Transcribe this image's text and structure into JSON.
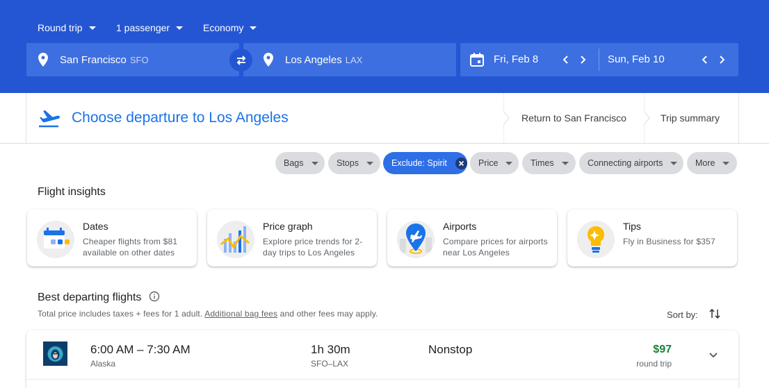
{
  "search": {
    "trip_type": "Round trip",
    "passengers": "1 passenger",
    "cabin": "Economy",
    "origin_city": "San Francisco",
    "origin_code": "SFO",
    "destination_city": "Los Angeles",
    "destination_code": "LAX",
    "depart_date": "Fri, Feb 8",
    "return_date": "Sun, Feb 10"
  },
  "steps": {
    "current": "Choose departure to Los Angeles",
    "next": "Return to San Francisco",
    "summary": "Trip summary"
  },
  "filters": [
    {
      "label": "Bags"
    },
    {
      "label": "Stops"
    },
    {
      "label": "Exclude: Spirit"
    },
    {
      "label": "Price"
    },
    {
      "label": "Times"
    },
    {
      "label": "Connecting airports"
    },
    {
      "label": "More"
    }
  ],
  "insights": {
    "heading": "Flight insights",
    "cards": [
      {
        "title": "Dates",
        "desc": "Cheaper flights from $81 available on other dates"
      },
      {
        "title": "Price graph",
        "desc": "Explore price trends for 2-day trips to Los Angeles"
      },
      {
        "title": "Airports",
        "desc": "Compare prices for airports near Los Angeles"
      },
      {
        "title": "Tips",
        "desc": "Fly in Business for $357"
      }
    ]
  },
  "results": {
    "heading": "Best departing flights",
    "note_prefix": "Total price includes taxes + fees for 1 adult.",
    "note_link": "Additional bag fees",
    "note_suffix": "and other fees may apply.",
    "sort_label": "Sort by:",
    "flights": [
      {
        "times": "6:00 AM – 7:30 AM",
        "airline": "Alaska",
        "duration": "1h 30m",
        "route": "SFO–LAX",
        "stops": "Nonstop",
        "price": "$97",
        "price_note": "round trip"
      }
    ]
  },
  "colors": {
    "header_blue": "#2456d4",
    "field_blue": "#3d6fe0",
    "link_blue": "#1a73e8",
    "price_green": "#188038"
  }
}
